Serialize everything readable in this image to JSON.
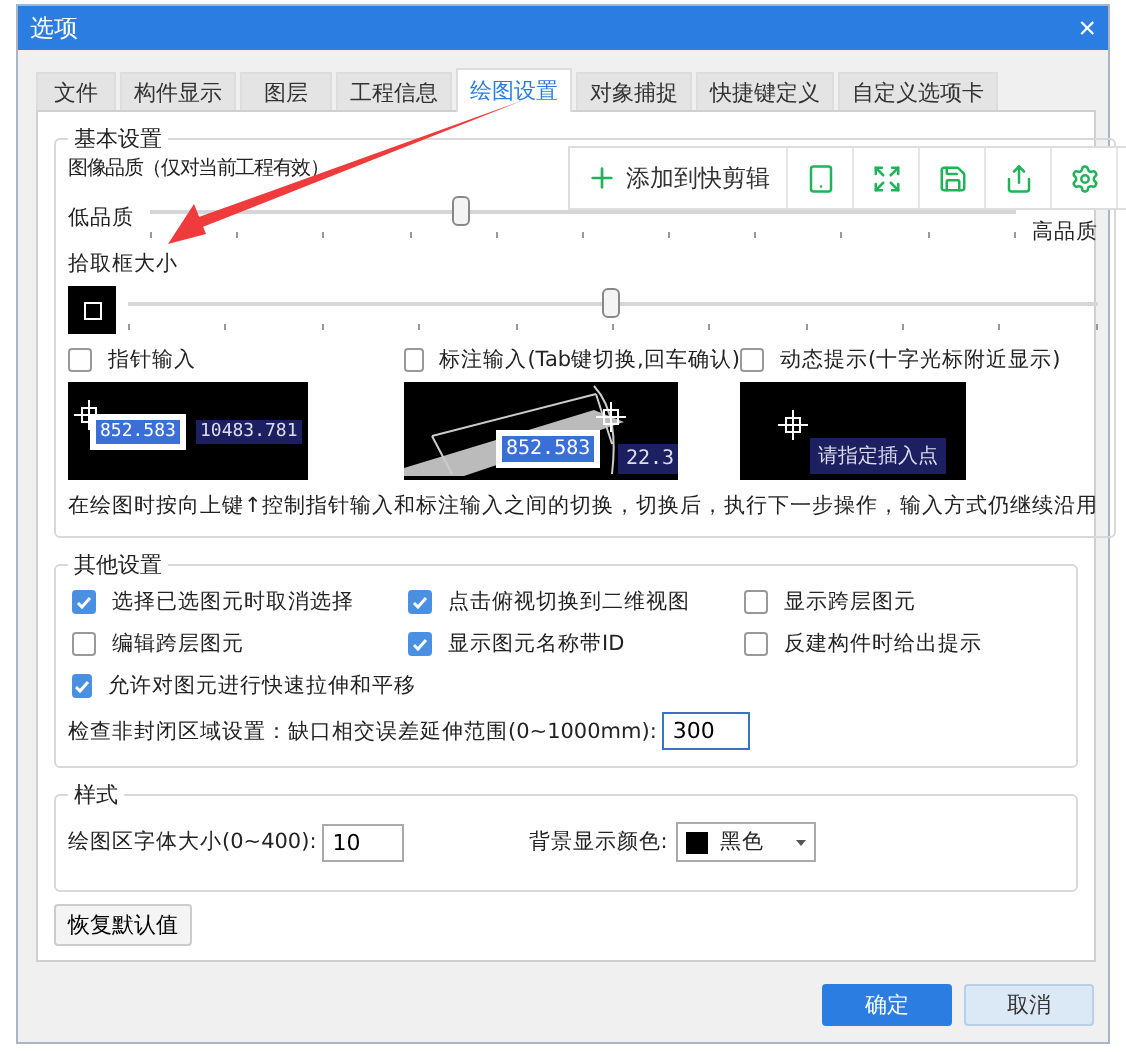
{
  "window": {
    "title": "选项",
    "close": "×"
  },
  "tabs": [
    {
      "label": "文件",
      "selected": false
    },
    {
      "label": "构件显示",
      "selected": false
    },
    {
      "label": "图层",
      "selected": false
    },
    {
      "label": "工程信息",
      "selected": false
    },
    {
      "label": "绘图设置",
      "selected": true
    },
    {
      "label": "对象捕捉",
      "selected": false
    },
    {
      "label": "快捷键定义",
      "selected": false
    },
    {
      "label": "自定义选项卡",
      "selected": false
    }
  ],
  "basic_settings": {
    "title": "基本设置",
    "image_quality": {
      "label": "图像品质（仅对当前工程有效）",
      "min_label": "低品质",
      "max_label": "高品质",
      "level": 0.36
    },
    "pick_box": {
      "label": "拾取框大小",
      "level": 0.5
    },
    "input_modes": [
      {
        "label": "指针输入",
        "checked": false,
        "preview": {
          "kind": "pointer",
          "values": [
            "852.583",
            "10483.781"
          ]
        }
      },
      {
        "label": "标注输入(Tab键切换,回车确认)",
        "checked": false,
        "preview": {
          "kind": "dimension",
          "values": [
            "852.583",
            "22.3"
          ]
        }
      },
      {
        "label": "动态提示(十字光标附近显示)",
        "checked": false,
        "preview": {
          "kind": "prompt",
          "values": [
            "请指定插入点"
          ]
        }
      }
    ],
    "note": "在绘图时按向上键↑控制指针输入和标注输入之间的切换，切换后，执行下一步操作，输入方式仍继续沿用"
  },
  "other_settings": {
    "title": "其他设置",
    "options": [
      {
        "label": "选择已选图元时取消选择",
        "checked": true
      },
      {
        "label": "点击俯视切换到二维视图",
        "checked": true
      },
      {
        "label": "显示跨层图元",
        "checked": false
      },
      {
        "label": "编辑跨层图元",
        "checked": false
      },
      {
        "label": "显示图元名称带ID",
        "checked": true
      },
      {
        "label": "反建构件时给出提示",
        "checked": false
      },
      {
        "label": "允许对图元进行快速拉伸和平移",
        "checked": true
      }
    ],
    "gap_check": {
      "label": "检查非封闭区域设置：缺口相交误差延伸范围(0~1000mm):",
      "value": "300"
    }
  },
  "style_settings": {
    "title": "样式",
    "font_size": {
      "label": "绘图区字体大小(0~400):",
      "value": "10"
    },
    "background_color": {
      "label": "背景显示颜色:",
      "value": "黑色",
      "color": "#000000"
    }
  },
  "restore_button": "恢复默认值",
  "buttons": [
    {
      "label": "确定",
      "kind": "primary"
    },
    {
      "label": "取消",
      "kind": "secondary"
    }
  ],
  "overlay_toolbar": {
    "add_label": "添加到快剪辑"
  }
}
